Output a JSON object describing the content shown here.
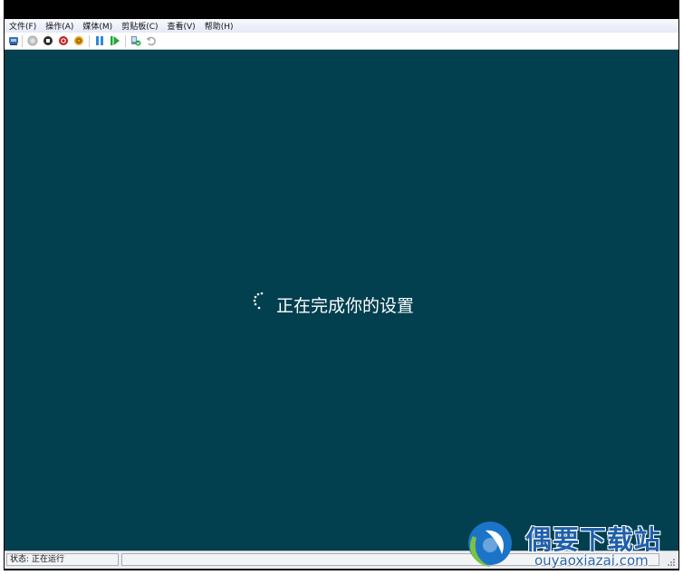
{
  "menubar": {
    "items": [
      {
        "label": "文件(F)"
      },
      {
        "label": "操作(A)"
      },
      {
        "label": "媒体(M)"
      },
      {
        "label": "剪贴板(C)"
      },
      {
        "label": "查看(V)"
      },
      {
        "label": "帮助(H)"
      }
    ]
  },
  "toolbar": {
    "icons": [
      "ctrl-alt-del-icon",
      "start-icon",
      "turn-off-icon",
      "shutdown-icon",
      "save-state-icon",
      "pause-icon",
      "reset-icon",
      "snapshot-icon",
      "revert-icon"
    ]
  },
  "vm_screen": {
    "message": "正在完成你的设置",
    "background": "#023f4f"
  },
  "statusbar": {
    "status_label": "状态:",
    "status_value": "正在运行"
  },
  "watermark": {
    "brand": "偶要下载站",
    "url": "ouyaoxiazai.com"
  }
}
